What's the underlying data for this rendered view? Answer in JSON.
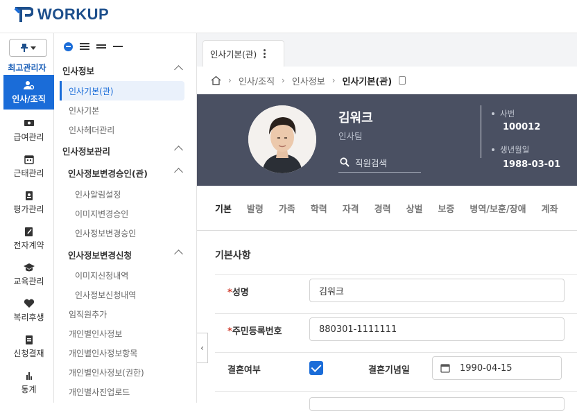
{
  "brand": {
    "name": "WORKUP",
    "color": "#1d4f8c"
  },
  "rail": {
    "role_label": "최고관리자",
    "items": [
      {
        "label": "인사/조직",
        "icon": "people-icon",
        "active": true
      },
      {
        "label": "급여관리",
        "icon": "money-icon"
      },
      {
        "label": "근태관리",
        "icon": "calendar-icon"
      },
      {
        "label": "평가관리",
        "icon": "clipboard-icon"
      },
      {
        "label": "전자계약",
        "icon": "edit-document-icon"
      },
      {
        "label": "교육관리",
        "icon": "graduation-cap-icon"
      },
      {
        "label": "복리후생",
        "icon": "heart-icon"
      },
      {
        "label": "신청결재",
        "icon": "approval-icon"
      },
      {
        "label": "통계",
        "icon": "bar-chart-icon"
      }
    ]
  },
  "menu": {
    "items": [
      {
        "label": "인사정보",
        "type": "section"
      },
      {
        "label": "인사기본(관)",
        "type": "active"
      },
      {
        "label": "인사기본",
        "type": "item"
      },
      {
        "label": "인사헤더관리",
        "type": "item"
      },
      {
        "label": "인사정보관리",
        "type": "section"
      },
      {
        "label": "인사정보변경승인(관)",
        "type": "subsection"
      },
      {
        "label": "인사알림설정",
        "type": "subitem"
      },
      {
        "label": "이미지변경승인",
        "type": "subitem"
      },
      {
        "label": "인사정보변경승인",
        "type": "subitem"
      },
      {
        "label": "인사정보변경신청",
        "type": "subsection"
      },
      {
        "label": "이미지신청내역",
        "type": "subitem"
      },
      {
        "label": "인사정보신청내역",
        "type": "subitem"
      },
      {
        "label": "임직원추가",
        "type": "item"
      },
      {
        "label": "개인별인사정보",
        "type": "item"
      },
      {
        "label": "개인별인사정보항목",
        "type": "item"
      },
      {
        "label": "개인별인사정보(권한)",
        "type": "item"
      },
      {
        "label": "개인별사진업로드",
        "type": "item"
      }
    ]
  },
  "tab": {
    "label": "인사기본(관)"
  },
  "breadcrumb": {
    "items": [
      "인사/조직",
      "인사정보"
    ],
    "current": "인사기본(관)"
  },
  "profile": {
    "name": "김워크",
    "dept": "인사팀",
    "search_placeholder": "직원검색",
    "emp_no_label": "사번",
    "emp_no": "100012",
    "birth_label": "생년월일",
    "birth": "1988-03-01"
  },
  "subtabs": [
    "기본",
    "발령",
    "가족",
    "학력",
    "자격",
    "경력",
    "상벌",
    "보증",
    "병역/보훈/장애",
    "계좌"
  ],
  "form": {
    "section_title": "기본사항",
    "name_label": "성명",
    "name_value": "김워크",
    "rrn_label": "주민등록번호",
    "rrn_value": "880301-1111111",
    "married_label": "결혼여부",
    "married_checked": true,
    "anniv_label": "결혼기념일",
    "anniv_value": "1990-04-15"
  },
  "colors": {
    "accent": "#1a6cd8",
    "profile_bg": "#4a5062",
    "required": "#d03a2b"
  }
}
